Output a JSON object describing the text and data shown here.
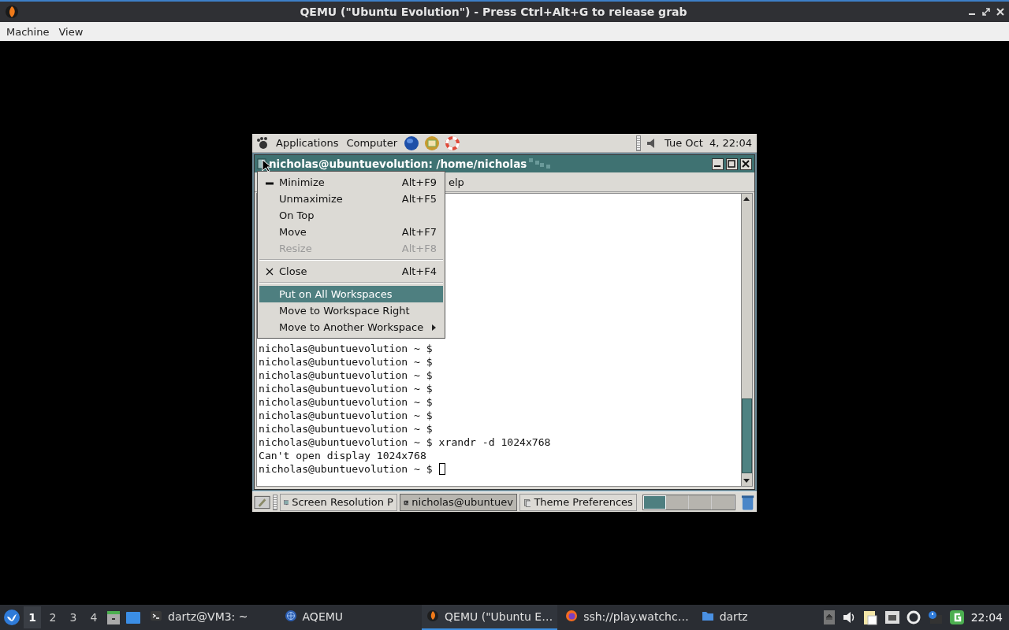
{
  "window": {
    "title": "QEMU (\"Ubuntu Evolution\") - Press Ctrl+Alt+G to release grab"
  },
  "menubar": [
    "Machine",
    "View"
  ],
  "guest": {
    "top_panel": {
      "menus": [
        "Applications",
        "Computer"
      ],
      "clock": "Tue Oct  4, 22:04"
    },
    "terminal": {
      "title": "nicholas@ubuntuevolution: /home/nicholas",
      "menu_visible": "elp",
      "lines": [
        "nicholas@ubuntuevolution ~ $",
        "nicholas@ubuntuevolution ~ $",
        "nicholas@ubuntuevolution ~ $",
        "nicholas@ubuntuevolution ~ $",
        "nicholas@ubuntuevolution ~ $",
        "nicholas@ubuntuevolution ~ $",
        "nicholas@ubuntuevolution ~ $",
        "nicholas@ubuntuevolution ~ $ xrandr -d 1024x768",
        "Can't open display 1024x768",
        "nicholas@ubuntuevolution ~ $ "
      ]
    },
    "window_menu": [
      {
        "kind": "item",
        "label": "Minimize",
        "shortcut": "Alt+F9",
        "disabled": false,
        "selected": false
      },
      {
        "kind": "item",
        "label": "Unmaximize",
        "shortcut": "Alt+F5",
        "disabled": false,
        "selected": false
      },
      {
        "kind": "item",
        "label": "On Top",
        "disabled": false,
        "selected": false
      },
      {
        "kind": "item",
        "label": "Move",
        "shortcut": "Alt+F7",
        "disabled": false,
        "selected": false
      },
      {
        "kind": "item",
        "label": "Resize",
        "shortcut": "Alt+F8",
        "disabled": true,
        "selected": false
      },
      {
        "kind": "separator"
      },
      {
        "kind": "item",
        "label": "Close",
        "shortcut": "Alt+F4",
        "disabled": false,
        "selected": false
      },
      {
        "kind": "separator"
      },
      {
        "kind": "item",
        "label": "Put on All Workspaces",
        "disabled": false,
        "selected": true
      },
      {
        "kind": "item",
        "label": "Move to Workspace Right",
        "disabled": false,
        "selected": false
      },
      {
        "kind": "item",
        "label": "Move to Another Workspace",
        "submenu": true,
        "disabled": false,
        "selected": false
      }
    ],
    "bottom_panel": {
      "tasks": [
        {
          "label": "Screen Resolution P",
          "selected": false
        },
        {
          "label": "nicholas@ubuntuev",
          "selected": true
        },
        {
          "label": "Theme Preferences",
          "selected": false
        }
      ],
      "workspaces": [
        {
          "selected": true
        },
        {
          "selected": false
        },
        {
          "selected": false
        },
        {
          "selected": false
        }
      ]
    }
  },
  "taskbar": {
    "workspaces": [
      {
        "label": "1",
        "selected": true
      },
      {
        "label": "2",
        "selected": false
      },
      {
        "label": "3",
        "selected": false
      },
      {
        "label": "4",
        "selected": false
      }
    ],
    "tasks": [
      {
        "label": "dartz@VM3: ~",
        "selected": false
      },
      {
        "label": "AQEMU",
        "selected": false
      },
      {
        "label": "QEMU (\"Ubuntu E…",
        "selected": true
      },
      {
        "label": "ssh://play.watchc…",
        "selected": false
      },
      {
        "label": "dartz",
        "selected": false
      }
    ],
    "clock": "22:04"
  }
}
